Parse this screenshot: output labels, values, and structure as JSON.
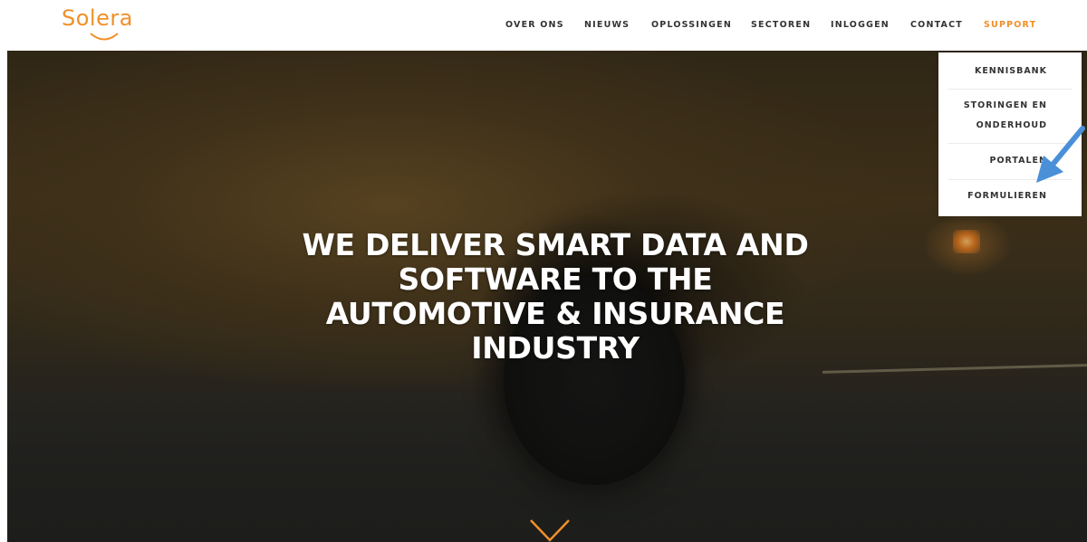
{
  "brand": {
    "logo_text": "Solera",
    "accent": "#f0902a"
  },
  "nav": {
    "items": [
      {
        "label": "OVER ONS"
      },
      {
        "label": "NIEUWS"
      },
      {
        "label": "OPLOSSINGEN"
      },
      {
        "label": "SECTOREN"
      },
      {
        "label": "INLOGGEN"
      },
      {
        "label": "CONTACT"
      },
      {
        "label": "SUPPORT",
        "active": true
      }
    ]
  },
  "support_menu": {
    "items": [
      {
        "label": "KENNISBANK"
      },
      {
        "label_line1": "STORINGEN EN",
        "label_line2": "ONDERHOUD"
      },
      {
        "label": "PORTALEN"
      },
      {
        "label": "FORMULIEREN"
      }
    ]
  },
  "hero": {
    "headline_lines": [
      "WE DELIVER SMART DATA AND",
      "SOFTWARE TO THE",
      "AUTOMOTIVE & INSURANCE",
      "INDUSTRY"
    ],
    "scroll_icon": "chevron-down-icon"
  },
  "annotation": {
    "icon": "arrow-pointer-icon",
    "color": "#4a90d9"
  }
}
